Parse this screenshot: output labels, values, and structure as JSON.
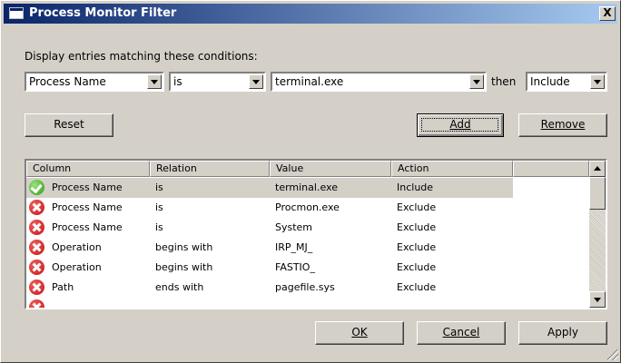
{
  "window": {
    "title": "Process Monitor Filter",
    "close_label": "X"
  },
  "filter": {
    "instructions": "Display entries matching these conditions:",
    "column_value": "Process Name",
    "relation_value": "is",
    "value_text": "terminal.exe",
    "then_label": "then",
    "action_value": "Include"
  },
  "buttons": {
    "reset": "Reset",
    "add": "Add",
    "remove": "Remove",
    "ok": "OK",
    "cancel": "Cancel",
    "apply": "Apply"
  },
  "table": {
    "headers": [
      "Column",
      "Relation",
      "Value",
      "Action"
    ],
    "rows": [
      {
        "status": "check-icon",
        "column": "Process Name",
        "relation": "is",
        "value": "terminal.exe",
        "action": "Include"
      },
      {
        "status": "x-icon",
        "column": "Process Name",
        "relation": "is",
        "value": "Procmon.exe",
        "action": "Exclude"
      },
      {
        "status": "x-icon",
        "column": "Process Name",
        "relation": "is",
        "value": "System",
        "action": "Exclude"
      },
      {
        "status": "x-icon",
        "column": "Operation",
        "relation": "begins with",
        "value": "IRP_MJ_",
        "action": "Exclude"
      },
      {
        "status": "x-icon",
        "column": "Operation",
        "relation": "begins with",
        "value": "FASTIO_",
        "action": "Exclude"
      },
      {
        "status": "x-icon",
        "column": "Path",
        "relation": "ends with",
        "value": "pagefile.sys",
        "action": "Exclude"
      }
    ]
  },
  "colors": {
    "include": "#2e9a16",
    "exclude": "#c41414",
    "title_bar": "#0a246a"
  }
}
